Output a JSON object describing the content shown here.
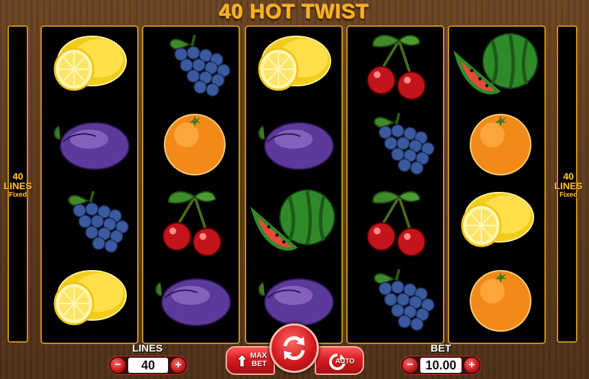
{
  "game": {
    "title": "40 HOT TWIST",
    "side_left": {
      "count": "40",
      "lines": "LINES",
      "fixed": "Fixed"
    },
    "side_right": {
      "count": "40",
      "lines": "LINES",
      "fixed": "Fixed"
    }
  },
  "reels": [
    [
      "lemon",
      "plum",
      "grapes",
      "lemon"
    ],
    [
      "grapes",
      "orange",
      "cherry",
      "plum"
    ],
    [
      "lemon",
      "plum",
      "watermelon",
      "plum"
    ],
    [
      "cherry",
      "grapes",
      "cherry",
      "grapes"
    ],
    [
      "watermelon",
      "orange",
      "lemon",
      "orange"
    ]
  ],
  "controls": {
    "lines_label": "LINES",
    "lines_value": "40",
    "minus": "−",
    "plus": "+",
    "max_bet_line1": "MAX",
    "max_bet_line2": "BET",
    "auto_label": "AUTO",
    "bet_label": "BET",
    "bet_value": "10.00"
  },
  "colors": {
    "title": "#ffb21a",
    "reel_border": "#c9921e",
    "button_red": "#d81d22"
  }
}
